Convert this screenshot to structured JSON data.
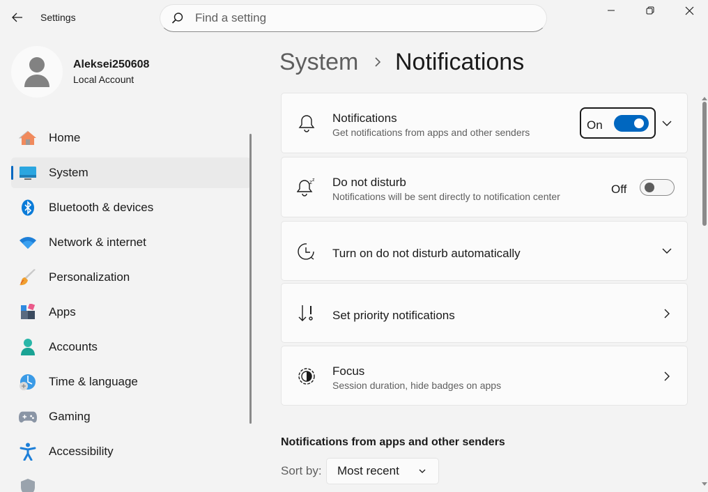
{
  "app": {
    "title": "Settings"
  },
  "search": {
    "placeholder": "Find a setting"
  },
  "user": {
    "name": "Aleksei250608",
    "type": "Local Account"
  },
  "sidebar": {
    "items": [
      {
        "label": "Home",
        "icon": "home-icon"
      },
      {
        "label": "System",
        "icon": "system-icon",
        "active": true
      },
      {
        "label": "Bluetooth & devices",
        "icon": "bluetooth-icon"
      },
      {
        "label": "Network & internet",
        "icon": "wifi-icon"
      },
      {
        "label": "Personalization",
        "icon": "brush-icon"
      },
      {
        "label": "Apps",
        "icon": "apps-icon"
      },
      {
        "label": "Accounts",
        "icon": "accounts-icon"
      },
      {
        "label": "Time & language",
        "icon": "time-language-icon"
      },
      {
        "label": "Gaming",
        "icon": "gamepad-icon"
      },
      {
        "label": "Accessibility",
        "icon": "accessibility-icon"
      }
    ]
  },
  "breadcrumb": {
    "parent": "System",
    "current": "Notifications"
  },
  "cards": {
    "notifications": {
      "title": "Notifications",
      "subtitle": "Get notifications from apps and other senders",
      "state_label": "On",
      "on": true
    },
    "dnd": {
      "title": "Do not disturb",
      "subtitle": "Notifications will be sent directly to notification center",
      "state_label": "Off",
      "on": false
    },
    "dnd_auto": {
      "title": "Turn on do not disturb automatically"
    },
    "priority": {
      "title": "Set priority notifications"
    },
    "focus": {
      "title": "Focus",
      "subtitle": "Session duration, hide badges on apps"
    }
  },
  "senders": {
    "heading": "Notifications from apps and other senders",
    "sort_label": "Sort by:",
    "sort_value": "Most recent"
  },
  "colors": {
    "accent": "#0067c0",
    "background": "#f3f3f3",
    "card": "#fbfbfb"
  }
}
